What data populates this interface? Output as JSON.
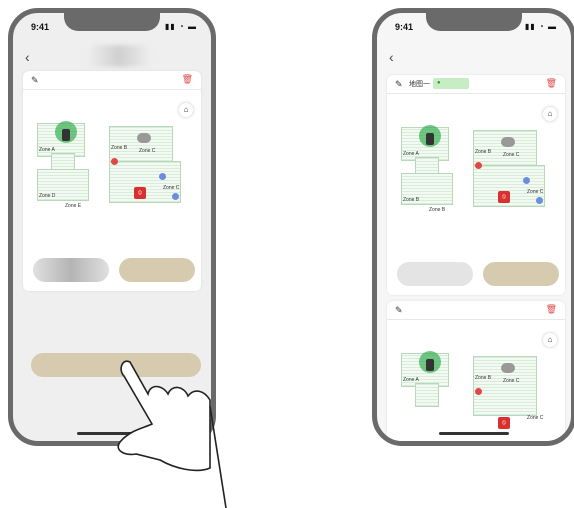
{
  "status": {
    "time": "9:41",
    "icons": "signal wifi battery"
  },
  "left_screen": {
    "map_card": {
      "zones": {
        "a": "Zone A",
        "b": "Zone B",
        "c": "Zone C",
        "d": "Zone D",
        "e": "Zone E",
        "c2": "Zone C"
      }
    }
  },
  "right_screen": {
    "map_card_1": {
      "name": "地图一",
      "zones": {
        "a": "Zone A",
        "b": "Zone B",
        "c": "Zone C",
        "b2": "Zone B",
        "b3": "Zone B",
        "c2": "Zone C"
      }
    },
    "map_card_2": {
      "zones": {
        "a": "Zone A",
        "b": "Zone B",
        "c": "Zone C",
        "c2": "Zone C"
      }
    }
  },
  "colors": {
    "accent_tan": "#d6cbaf",
    "map_green": "#d8ecd8",
    "delete_red": "#e04848"
  }
}
